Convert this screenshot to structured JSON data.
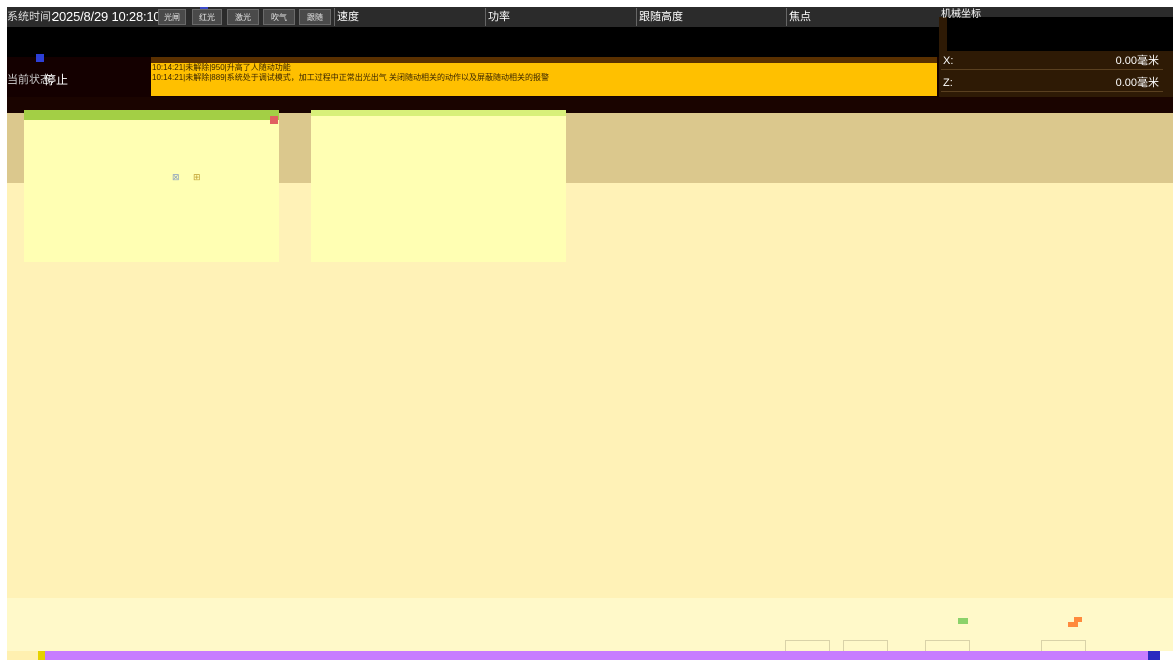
{
  "header": {
    "time_label": "系统时间:",
    "time_value": "2025/8/29 10:28:10",
    "toggles": [
      "光闸",
      "红光",
      "激光",
      "吹气",
      "跟随"
    ],
    "columns": [
      "速度",
      "功率",
      "跟随高度",
      "焦点",
      "机械坐标"
    ]
  },
  "status": {
    "label": "当前状态:",
    "value": "停止"
  },
  "log": {
    "lines": [
      "10:14:21|未解除|950|升高了人随动功能",
      "10:14:21|未解除|889|系统处于调试模式，加工过程中正常出光出气 关闭随动相关的动作以及屏蔽随动相关的报警"
    ]
  },
  "coords": {
    "x": {
      "axis": "X:",
      "value": "0.00毫米"
    },
    "z": {
      "axis": "Z:",
      "value": "0.00毫米"
    }
  },
  "colors": {
    "toolbar": "#2b2b2b",
    "log_background": "#ffc000",
    "card_header": "#a3cf45",
    "card_body": "#ffffb3",
    "canvas": "#fff2b7",
    "bottom_bar": "#c77dff"
  }
}
